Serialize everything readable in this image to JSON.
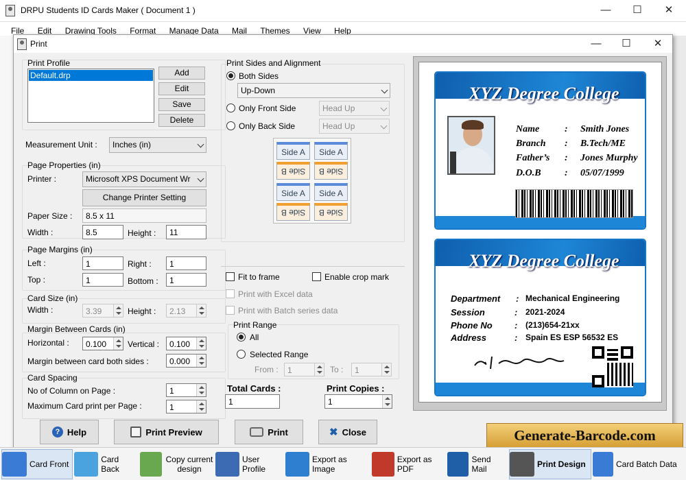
{
  "app": {
    "title": "DRPU Students ID Cards Maker ( Document 1 )",
    "menu": [
      "File",
      "Edit",
      "Drawing Tools",
      "Format",
      "Manage Data",
      "Mail",
      "Themes",
      "View",
      "Help"
    ],
    "window_controls": {
      "minimize": "—",
      "maximize": "☐",
      "close": "✕"
    }
  },
  "dialog": {
    "title": "Print",
    "controls": {
      "minimize": "—",
      "maximize": "☐",
      "close": "✕"
    },
    "print_profile": {
      "label": "Print Profile",
      "items": [
        "Default.drp"
      ],
      "add": "Add",
      "edit": "Edit",
      "save": "Save",
      "delete": "Delete"
    },
    "measurement_unit": {
      "label": "Measurement Unit :",
      "value": "Inches (in)"
    },
    "page_properties": {
      "label": "Page Properties (in)",
      "printer_label": "Printer :",
      "printer_value": "Microsoft XPS Document Wr",
      "change_printer": "Change Printer Setting",
      "paper_size_label": "Paper Size :",
      "paper_size_value": "8.5 x 11",
      "width_label": "Width :",
      "width_value": "8.5",
      "height_label": "Height :",
      "height_value": "11"
    },
    "page_margins": {
      "label": "Page Margins (in)",
      "left_label": "Left :",
      "left_value": "1",
      "right_label": "Right :",
      "right_value": "1",
      "top_label": "Top :",
      "top_value": "1",
      "bottom_label": "Bottom :",
      "bottom_value": "1"
    },
    "card_size": {
      "label": "Card Size (in)",
      "width_label": "Width :",
      "width_value": "3.39",
      "height_label": "Height :",
      "height_value": "2.13"
    },
    "margin_between": {
      "label": "Margin Between Cards (in)",
      "horizontal_label": "Horizontal :",
      "horizontal_value": "0.100",
      "vertical_label": "Vertical :",
      "vertical_value": "0.100",
      "both_label": "Margin between card both sides :",
      "both_value": "0.000"
    },
    "card_spacing": {
      "label": "Card Spacing",
      "columns_label": "No of Column on Page :",
      "columns_value": "1",
      "max_label": "Maximum Card print per Page :",
      "max_value": "1"
    },
    "sides": {
      "label": "Print Sides and Alignment",
      "both": "Both Sides",
      "both_mode": "Up-Down",
      "front": "Only Front Side",
      "front_mode": "Head Up",
      "back": "Only Back Side",
      "back_mode": "Head Up",
      "tile_a": "Side A",
      "tile_b": "Side B"
    },
    "options": {
      "fit_frame": "Fit to frame",
      "crop_mark": "Enable crop mark",
      "excel": "Print with Excel data",
      "batch": "Print with Batch series data"
    },
    "print_range": {
      "label": "Print Range",
      "all": "All",
      "selected": "Selected Range",
      "from_label": "From :",
      "from_value": "1",
      "to_label": "To :",
      "to_value": "1"
    },
    "totals": {
      "total_label": "Total Cards :",
      "total_value": "1",
      "copies_label": "Print Copies :",
      "copies_value": "1"
    },
    "buttons": {
      "help": "Help",
      "preview": "Print Preview",
      "print": "Print",
      "close": "Close"
    }
  },
  "card_front": {
    "college": "XYZ Degree College",
    "fields": [
      {
        "key": "Name",
        "sep": ":",
        "value": "Smith Jones"
      },
      {
        "key": "Branch",
        "sep": ":",
        "value": "B.Tech/ME"
      },
      {
        "key": "Father’s",
        "sep": ":",
        "value": "Jones Murphy"
      },
      {
        "key": "D.O.B",
        "sep": ":",
        "value": "05/07/1999"
      }
    ]
  },
  "card_back": {
    "college": "XYZ Degree College",
    "fields": [
      {
        "key": "Department",
        "sep": ":",
        "value": "Mechanical Engineering"
      },
      {
        "key": "Session",
        "sep": ":",
        "value": "2021-2024"
      },
      {
        "key": "Phone No",
        "sep": ":",
        "value": "(213)654-21xx"
      },
      {
        "key": "Address",
        "sep": ":",
        "value": "Spain ES ESP 56532 ES"
      }
    ]
  },
  "watermark": "Generate-Barcode.com",
  "taskbar": [
    {
      "label": "Card Front",
      "icon": "card-front-icon",
      "color": "#3a7bd5"
    },
    {
      "label": "Card Back",
      "icon": "card-back-icon",
      "color": "#4aa3df"
    },
    {
      "label": "Copy current design",
      "icon": "copy-design-icon",
      "color": "#6aa84f"
    },
    {
      "label": "User Profile",
      "icon": "user-profile-icon",
      "color": "#3d6bb3"
    },
    {
      "label": "Export as Image",
      "icon": "export-image-icon",
      "color": "#2f7fd0"
    },
    {
      "label": "Export as PDF",
      "icon": "export-pdf-icon",
      "color": "#c0392b"
    },
    {
      "label": "Send Mail",
      "icon": "send-mail-icon",
      "color": "#1f5fa8"
    },
    {
      "label": "Print Design",
      "icon": "print-design-icon",
      "color": "#555555"
    },
    {
      "label": "Card Batch Data",
      "icon": "card-batch-icon",
      "color": "#3a7bd5"
    }
  ],
  "colors": {
    "card_blue": "#1677c8",
    "watermark_bg": "#e8b64a"
  }
}
